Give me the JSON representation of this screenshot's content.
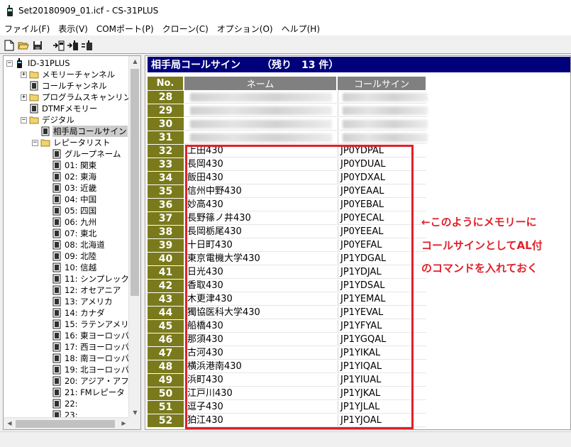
{
  "window": {
    "title": "Set20180909_01.icf - CS-31PLUS"
  },
  "menu": [
    "ファイル(F)",
    "表示(V)",
    "COMポート(P)",
    "クローン(C)",
    "オプション(O)",
    "ヘルプ(H)"
  ],
  "toolbar": {
    "icons": [
      "new-file-icon",
      "open-folder-icon",
      "save-icon",
      "read-from-radio-icon",
      "write-to-radio-icon",
      "clone-icon"
    ]
  },
  "tree": {
    "items": [
      {
        "label": "ID-31PLUS",
        "level": 0,
        "icon": "radio-icon",
        "expander": "−"
      },
      {
        "label": "メモリーチャンネル",
        "level": 1,
        "icon": "folder-icon",
        "expander": "+"
      },
      {
        "label": "コールチャンネル",
        "level": 1,
        "icon": "sheet-icon",
        "expander": ""
      },
      {
        "label": "プログラムスキャンリン",
        "level": 1,
        "icon": "folder-icon",
        "expander": "+"
      },
      {
        "label": "DTMFメモリー",
        "level": 1,
        "icon": "sheet-icon",
        "expander": ""
      },
      {
        "label": "デジタル",
        "level": 1,
        "icon": "folder-icon",
        "expander": "−"
      },
      {
        "label": "相手局コールサイン",
        "level": 2,
        "icon": "sheet-icon",
        "expander": "",
        "selected": true
      },
      {
        "label": "レピータリスト",
        "level": 2,
        "icon": "folder-icon",
        "expander": "−"
      },
      {
        "label": "グループネーム",
        "level": 3,
        "icon": "sheet-icon",
        "expander": ""
      },
      {
        "label": "01: 関東",
        "level": 3,
        "icon": "sheet-icon",
        "expander": ""
      },
      {
        "label": "02: 東海",
        "level": 3,
        "icon": "sheet-icon",
        "expander": ""
      },
      {
        "label": "03: 近畿",
        "level": 3,
        "icon": "sheet-icon",
        "expander": ""
      },
      {
        "label": "04: 中国",
        "level": 3,
        "icon": "sheet-icon",
        "expander": ""
      },
      {
        "label": "05: 四国",
        "level": 3,
        "icon": "sheet-icon",
        "expander": ""
      },
      {
        "label": "06: 九州",
        "level": 3,
        "icon": "sheet-icon",
        "expander": ""
      },
      {
        "label": "07: 東北",
        "level": 3,
        "icon": "sheet-icon",
        "expander": ""
      },
      {
        "label": "08: 北海道",
        "level": 3,
        "icon": "sheet-icon",
        "expander": ""
      },
      {
        "label": "09: 北陸",
        "level": 3,
        "icon": "sheet-icon",
        "expander": ""
      },
      {
        "label": "10: 信越",
        "level": 3,
        "icon": "sheet-icon",
        "expander": ""
      },
      {
        "label": "11: シンプレック",
        "level": 3,
        "icon": "sheet-icon",
        "expander": ""
      },
      {
        "label": "12: オセアニア",
        "level": 3,
        "icon": "sheet-icon",
        "expander": ""
      },
      {
        "label": "13: アメリカ",
        "level": 3,
        "icon": "sheet-icon",
        "expander": ""
      },
      {
        "label": "14: カナダ",
        "level": 3,
        "icon": "sheet-icon",
        "expander": ""
      },
      {
        "label": "15: ラテンアメリ",
        "level": 3,
        "icon": "sheet-icon",
        "expander": ""
      },
      {
        "label": "16: 東ヨーロッパ",
        "level": 3,
        "icon": "sheet-icon",
        "expander": ""
      },
      {
        "label": "17: 西ヨーロッパ",
        "level": 3,
        "icon": "sheet-icon",
        "expander": ""
      },
      {
        "label": "18: 南ヨーロッパ",
        "level": 3,
        "icon": "sheet-icon",
        "expander": ""
      },
      {
        "label": "19: 北ヨーロッパ",
        "level": 3,
        "icon": "sheet-icon",
        "expander": ""
      },
      {
        "label": "20: アジア・アフ",
        "level": 3,
        "icon": "sheet-icon",
        "expander": ""
      },
      {
        "label": "21: FMレピータ",
        "level": 3,
        "icon": "sheet-icon",
        "expander": ""
      },
      {
        "label": "22:",
        "level": 3,
        "icon": "sheet-icon",
        "expander": ""
      },
      {
        "label": "23:",
        "level": 3,
        "icon": "sheet-icon",
        "expander": ""
      }
    ]
  },
  "section": {
    "title": "相手局コールサイン",
    "count": "（残り　13 件）"
  },
  "table": {
    "headers": [
      "No.",
      "ネーム",
      "コールサイン"
    ],
    "rows": [
      {
        "no": "28",
        "name": "",
        "call": "",
        "blurred": true
      },
      {
        "no": "29",
        "name": "",
        "call": "",
        "blurred": true
      },
      {
        "no": "30",
        "name": "",
        "call": "",
        "blurred": true
      },
      {
        "no": "31",
        "name": "",
        "call": "",
        "blurred": true
      },
      {
        "no": "32",
        "name": "上田430",
        "call": "JP0YDPAL"
      },
      {
        "no": "33",
        "name": "長岡430",
        "call": "JP0YDUAL"
      },
      {
        "no": "34",
        "name": "飯田430",
        "call": "JP0YDXAL"
      },
      {
        "no": "35",
        "name": "信州中野430",
        "call": "JP0YEAAL"
      },
      {
        "no": "36",
        "name": "妙高430",
        "call": "JP0YEBAL"
      },
      {
        "no": "37",
        "name": "長野篠ノ井430",
        "call": "JP0YECAL"
      },
      {
        "no": "38",
        "name": "長岡栃尾430",
        "call": "JP0YEEAL"
      },
      {
        "no": "39",
        "name": "十日町430",
        "call": "JP0YEFAL"
      },
      {
        "no": "40",
        "name": "東京電機大学430",
        "call": "JP1YDGAL"
      },
      {
        "no": "41",
        "name": "日光430",
        "call": "JP1YDJAL"
      },
      {
        "no": "42",
        "name": "香取430",
        "call": "JP1YDSAL"
      },
      {
        "no": "43",
        "name": "木更津430",
        "call": "JP1YEMAL"
      },
      {
        "no": "44",
        "name": "獨協医科大学430",
        "call": "JP1YEVAL"
      },
      {
        "no": "45",
        "name": "船橋430",
        "call": "JP1YFYAL"
      },
      {
        "no": "46",
        "name": "那須430",
        "call": "JP1YGQAL"
      },
      {
        "no": "47",
        "name": "古河430",
        "call": "JP1YIKAL"
      },
      {
        "no": "48",
        "name": "横浜港南430",
        "call": "JP1YIQAL"
      },
      {
        "no": "49",
        "name": "浜町430",
        "call": "JP1YIUAL"
      },
      {
        "no": "50",
        "name": "江戸川430",
        "call": "JP1YJKAL"
      },
      {
        "no": "51",
        "name": "逗子430",
        "call": "JP1YJLAL"
      },
      {
        "no": "52",
        "name": "狛江430",
        "call": "JP1YJOAL"
      }
    ]
  },
  "annotation": {
    "lines": [
      "←このようにメモリーに",
      "コールサインとしてAL付",
      "のコマンドを入れておく"
    ],
    "color": "#e0202a"
  },
  "colors": {
    "header_bg": "#00007b",
    "no_col_bg": "#7a7a1c",
    "col_head_bg": "#808080"
  }
}
